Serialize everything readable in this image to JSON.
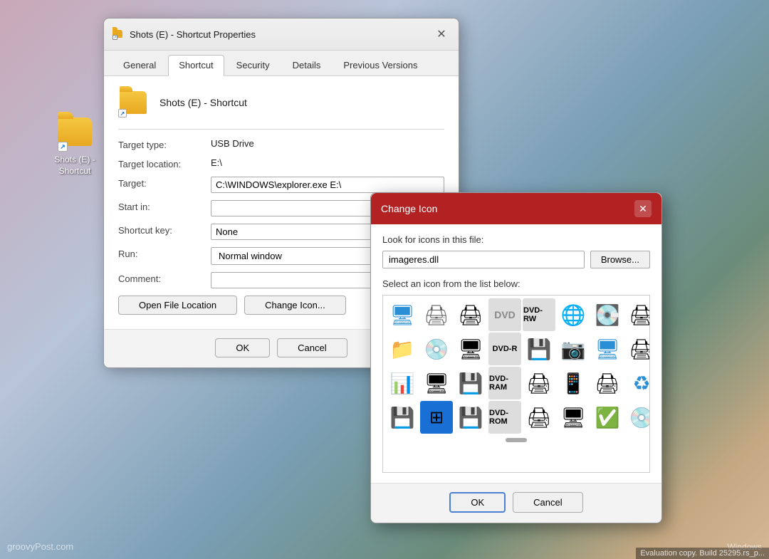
{
  "desktop": {
    "icon": {
      "label_line1": "Shots (E) -",
      "label_line2": "Shortcut"
    },
    "watermark_left": "groovyPost.com",
    "watermark_right": "Windows",
    "eval_text": "Evaluation copy. Build 25295.rs_p..."
  },
  "properties_dialog": {
    "title": "Shots (E) - Shortcut Properties",
    "tabs": [
      "General",
      "Shortcut",
      "Security",
      "Details",
      "Previous Versions"
    ],
    "active_tab": "Shortcut",
    "file_name": "Shots (E) - Shortcut",
    "target_type_label": "Target type:",
    "target_type_value": "USB Drive",
    "target_location_label": "Target location:",
    "target_location_value": "E:\\",
    "target_label": "Target:",
    "target_value": "C:\\WINDOWS\\explorer.exe E:\\",
    "start_in_label": "Start in:",
    "start_in_value": "",
    "shortcut_key_label": "Shortcut key:",
    "shortcut_key_value": "None",
    "run_label": "Run:",
    "run_value": "Normal window",
    "comment_label": "Comment:",
    "comment_value": "",
    "btn_open_file": "Open File Location",
    "btn_change_icon": "Change Icon...",
    "btn_ok": "OK",
    "btn_cancel": "Cancel"
  },
  "change_icon_dialog": {
    "title": "Change Icon",
    "look_for_label": "Look for icons in this file:",
    "file_value": "imageres.dll",
    "browse_label": "Browse...",
    "select_label": "Select an icon from the list below:",
    "btn_ok": "OK",
    "btn_cancel": "Cancel"
  }
}
